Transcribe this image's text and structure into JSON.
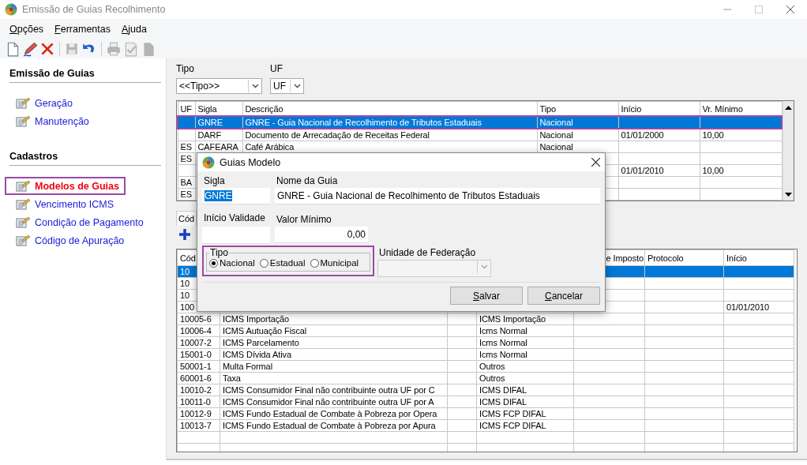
{
  "window": {
    "title": "Emissão de Guias Recolhimento"
  },
  "menu": [
    "Opções",
    "Ferramentas",
    "Ajuda"
  ],
  "toolbar_groups": [
    {
      "buttons": [
        {
          "kind": "new",
          "disabled": false
        },
        {
          "kind": "edit",
          "disabled": false
        },
        {
          "kind": "delete",
          "disabled": false
        }
      ]
    },
    {
      "buttons": [
        {
          "kind": "save",
          "disabled": true
        },
        {
          "kind": "undo",
          "disabled": false
        }
      ]
    },
    {
      "buttons": [
        {
          "kind": "print",
          "disabled": true
        },
        {
          "kind": "approve",
          "disabled": true
        },
        {
          "kind": "document",
          "disabled": true
        }
      ]
    }
  ],
  "sidebar": [
    {
      "heading": "Emissão de Guias",
      "items": [
        {
          "label": "Geração",
          "selected": false,
          "highlighted": false
        },
        {
          "label": "Manutenção",
          "selected": false,
          "highlighted": false
        }
      ]
    },
    {
      "heading": "Cadastros",
      "items": [
        {
          "label": "Modelos de Guias",
          "selected": true,
          "highlighted": true
        },
        {
          "label": "Vencimento ICMS",
          "selected": false,
          "highlighted": false
        },
        {
          "label": "Condição de Pagamento",
          "selected": false,
          "highlighted": false
        },
        {
          "label": "Código de Apuração",
          "selected": false,
          "highlighted": false
        }
      ]
    }
  ],
  "filters": [
    {
      "label": "Tipo",
      "value": "<<Tipo>>"
    },
    {
      "label": "UF",
      "value": "UF"
    }
  ],
  "guides_table": {
    "columns": [
      "UF",
      "Sigla",
      "Descrição",
      "Tipo",
      "Início",
      "Vr. Mínimo"
    ],
    "rows": [
      {
        "cells": [
          "",
          "GNRE",
          "GNRE - Guia Nacional de Recolhimento de Tributos Estaduais",
          "Nacional",
          "",
          ""
        ],
        "selected": true,
        "highlighted": true
      },
      {
        "cells": [
          "",
          "DARF",
          "Documento de Arrecadação de Receitas Federal",
          "Nacional",
          "01/01/2000",
          "10,00"
        ],
        "selected": false,
        "highlighted": false
      },
      {
        "cells": [
          "ES",
          "CAFEARA",
          "Café Arábica",
          "Nacional",
          "",
          ""
        ],
        "selected": false,
        "highlighted": false
      },
      {
        "cells": [
          "ES",
          "",
          "",
          "",
          "",
          ""
        ],
        "selected": false,
        "highlighted": false
      },
      {
        "cells": [
          "",
          "",
          "",
          "",
          "01/01/2010",
          "10,00"
        ],
        "selected": false,
        "highlighted": false
      },
      {
        "cells": [
          "BA",
          "",
          "",
          "",
          "",
          ""
        ],
        "selected": false,
        "highlighted": false
      },
      {
        "cells": [
          "ES",
          "",
          "",
          "",
          "",
          ""
        ],
        "selected": false,
        "highlighted": false
      }
    ]
  },
  "codes_tab": {
    "label": "Cód"
  },
  "codes_table": {
    "columns": [
      "Cód",
      "",
      "",
      "",
      "e Imposto",
      "Protocolo",
      "Início"
    ],
    "rows": [
      {
        "cells": [
          "10",
          "",
          "",
          "",
          "",
          "",
          ""
        ],
        "selected": true
      },
      {
        "cells": [
          "10",
          "",
          "",
          "",
          "",
          "",
          ""
        ],
        "selected": false
      },
      {
        "cells": [
          "10",
          "",
          "",
          "",
          "",
          "",
          ""
        ],
        "selected": false
      },
      {
        "cells": [
          "100",
          "",
          "",
          "",
          "",
          "",
          "01/01/2010"
        ],
        "selected": false
      },
      {
        "cells": [
          "10005-6",
          "ICMS Importação",
          "",
          "ICMS Importação",
          "",
          "",
          ""
        ],
        "selected": false
      },
      {
        "cells": [
          "10006-4",
          "ICMS Autuação Fiscal",
          "",
          "Icms Normal",
          "",
          "",
          ""
        ],
        "selected": false
      },
      {
        "cells": [
          "10007-2",
          "ICMS Parcelamento",
          "",
          "Icms Normal",
          "",
          "",
          ""
        ],
        "selected": false
      },
      {
        "cells": [
          "15001-0",
          "ICMS Dívida Ativa",
          "",
          "Icms Normal",
          "",
          "",
          ""
        ],
        "selected": false
      },
      {
        "cells": [
          "50001-1",
          "Multa Formal",
          "",
          "Outros",
          "",
          "",
          ""
        ],
        "selected": false
      },
      {
        "cells": [
          "60001-6",
          "Taxa",
          "",
          "Outros",
          "",
          "",
          ""
        ],
        "selected": false
      },
      {
        "cells": [
          "10010-2",
          "ICMS Consumidor Final não contribuinte outra UF por C",
          "",
          "ICMS DIFAL",
          "",
          "",
          ""
        ],
        "selected": false
      },
      {
        "cells": [
          "10011-0",
          "ICMS Consumidor Final não contribuinte outra UF por A",
          "",
          "ICMS DIFAL",
          "",
          "",
          ""
        ],
        "selected": false
      },
      {
        "cells": [
          "10012-9",
          "ICMS Fundo Estadual de Combate à Pobreza por Opera",
          "",
          "ICMS FCP DIFAL",
          "",
          "",
          ""
        ],
        "selected": false
      },
      {
        "cells": [
          "10013-7",
          "ICMS Fundo Estadual de Combate à Pobreza por Apura",
          "",
          "ICMS FCP DIFAL",
          "",
          "",
          ""
        ],
        "selected": false
      },
      {
        "cells": [
          "",
          "",
          "",
          "",
          "",
          "",
          ""
        ],
        "selected": false
      },
      {
        "cells": [
          "",
          "",
          "",
          "",
          "",
          "",
          ""
        ],
        "selected": false
      }
    ]
  },
  "dialog": {
    "title": "Guias Modelo",
    "sigla": {
      "label": "Sigla",
      "value": "GNRE",
      "text_selected": true
    },
    "nome": {
      "label": "Nome da Guia",
      "value": "GNRE - Guia Nacional de Recolhimento de Tributos Estaduais"
    },
    "inicio": {
      "label": "Início Validade"
    },
    "valor": {
      "label": "Valor Mínimo",
      "value": "0,00"
    },
    "tipo": {
      "label": "Tipo",
      "highlighted": true,
      "options": [
        {
          "label": "Nacional",
          "selected": true
        },
        {
          "label": "Estadual",
          "selected": false
        },
        {
          "label": "Municipal",
          "selected": false
        }
      ]
    },
    "uf": {
      "label": "Unidade de Federação",
      "disabled": true
    },
    "buttons": [
      "Salvar",
      "Cancelar"
    ]
  }
}
